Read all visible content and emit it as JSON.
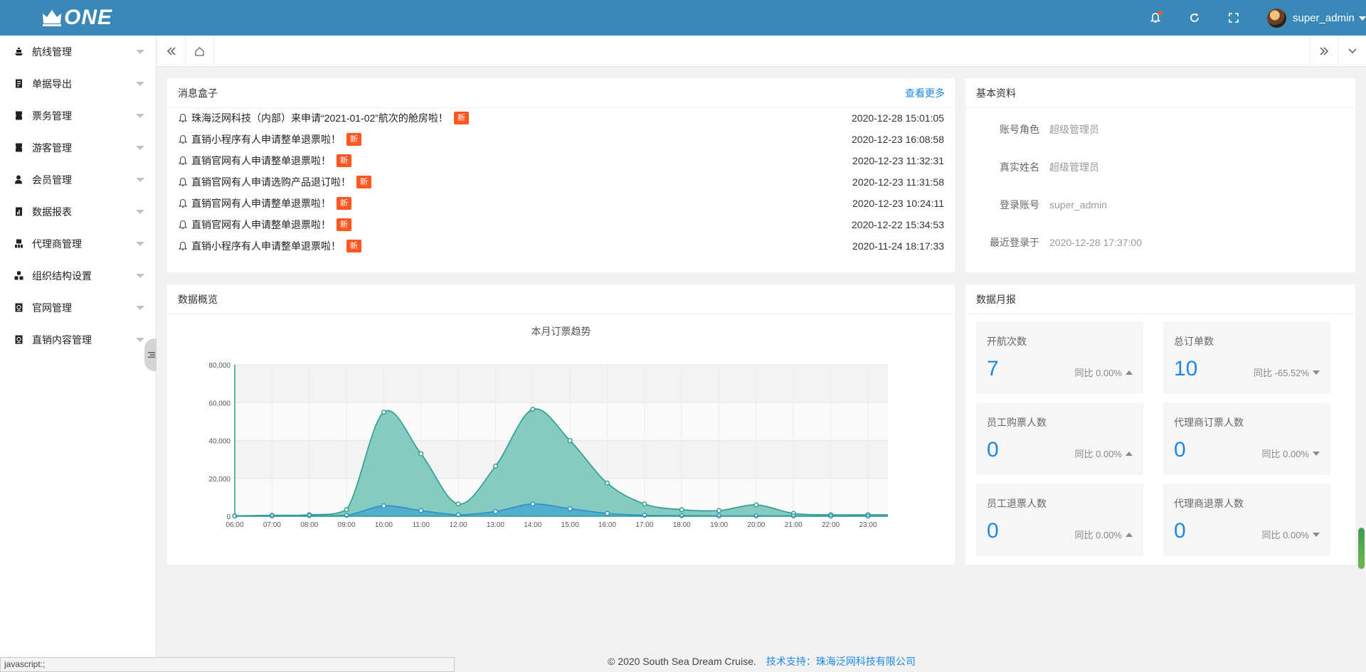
{
  "header": {
    "logo_text": "ONE",
    "username": "super_admin"
  },
  "sidebar": {
    "items": [
      {
        "label": "航线管理",
        "icon": "ship-icon"
      },
      {
        "label": "单据导出",
        "icon": "document-icon"
      },
      {
        "label": "票务管理",
        "icon": "ticket-icon"
      },
      {
        "label": "游客管理",
        "icon": "ticket-icon"
      },
      {
        "label": "会员管理",
        "icon": "user-icon"
      },
      {
        "label": "数据报表",
        "icon": "report-icon"
      },
      {
        "label": "代理商管理",
        "icon": "agent-icon"
      },
      {
        "label": "组织结构设置",
        "icon": "org-icon"
      },
      {
        "label": "官网管理",
        "icon": "web-icon"
      },
      {
        "label": "直销内容管理",
        "icon": "web-icon"
      }
    ]
  },
  "messages": {
    "title": "消息盒子",
    "more": "查看更多",
    "badge": "新",
    "items": [
      {
        "text": "珠海泛网科技（内部）来申请“2021-01-02”航次的舱房啦！",
        "time": "2020-12-28 15:01:05"
      },
      {
        "text": "直销小程序有人申请整单退票啦！",
        "time": "2020-12-23 16:08:58"
      },
      {
        "text": "直销官网有人申请整单退票啦！",
        "time": "2020-12-23 11:32:31"
      },
      {
        "text": "直销官网有人申请选购产品退订啦！",
        "time": "2020-12-23 11:31:58"
      },
      {
        "text": "直销官网有人申请整单退票啦！",
        "time": "2020-12-23 10:24:11"
      },
      {
        "text": "直销官网有人申请整单退票啦！",
        "time": "2020-12-22 15:34:53"
      },
      {
        "text": "直销小程序有人申请整单退票啦！",
        "time": "2020-11-24 18:17:33"
      }
    ]
  },
  "profile": {
    "title": "基本资料",
    "rows": [
      {
        "key": "账号角色",
        "value": "超级管理员"
      },
      {
        "key": "真实姓名",
        "value": "超级管理员"
      },
      {
        "key": "登录账号",
        "value": "super_admin"
      },
      {
        "key": "最近登录于",
        "value": "2020-12-28 17:37:00"
      }
    ]
  },
  "overview": {
    "title": "数据概览"
  },
  "chart_data": {
    "type": "area",
    "title": "本月订票趋势",
    "x": [
      "06:00",
      "07:00",
      "08:00",
      "09:00",
      "10:00",
      "11:00",
      "12:00",
      "13:00",
      "14:00",
      "15:00",
      "16:00",
      "17:00",
      "18:00",
      "19:00",
      "20:00",
      "21:00",
      "22:00",
      "23:00"
    ],
    "ylim": [
      0,
      80000
    ],
    "yticks": [
      "0",
      "20,000",
      "40,000",
      "60,000",
      "80,000"
    ],
    "colors": {
      "series1": "#2a9d8f",
      "series1_fill": "#7ec8bd",
      "series2": "#2b8fc7",
      "series2_fill": "#4aa8cf"
    },
    "series": [
      {
        "values": [
          200,
          500,
          800,
          3500,
          55000,
          33000,
          6500,
          26500,
          56500,
          40000,
          17500,
          6500,
          3500,
          3000,
          6000,
          1500,
          800,
          800
        ]
      },
      {
        "values": [
          100,
          200,
          300,
          500,
          5500,
          3000,
          800,
          2500,
          6500,
          4000,
          1500,
          500,
          300,
          200,
          200,
          200,
          100,
          100
        ]
      }
    ]
  },
  "monthly": {
    "title": "数据月报",
    "stats": [
      {
        "label": "开航次数",
        "value": "7",
        "compare": "同比 0.00%",
        "dir": "up"
      },
      {
        "label": "总订单数",
        "value": "10",
        "compare": "同比 -65.52%",
        "dir": "down"
      },
      {
        "label": "员工购票人数",
        "value": "0",
        "compare": "同比 0.00%",
        "dir": "up"
      },
      {
        "label": "代理商订票人数",
        "value": "0",
        "compare": "同比 0.00%",
        "dir": "down"
      },
      {
        "label": "员工退票人数",
        "value": "0",
        "compare": "同比 0.00%",
        "dir": "up"
      },
      {
        "label": "代理商退票人数",
        "value": "0",
        "compare": "同比 0.00%",
        "dir": "down"
      }
    ]
  },
  "footer": {
    "copyright": "© 2020 South Sea Dream Cruise.",
    "tech": "技术支持：珠海泛网科技有限公司"
  },
  "statusbar": "javascript:;"
}
